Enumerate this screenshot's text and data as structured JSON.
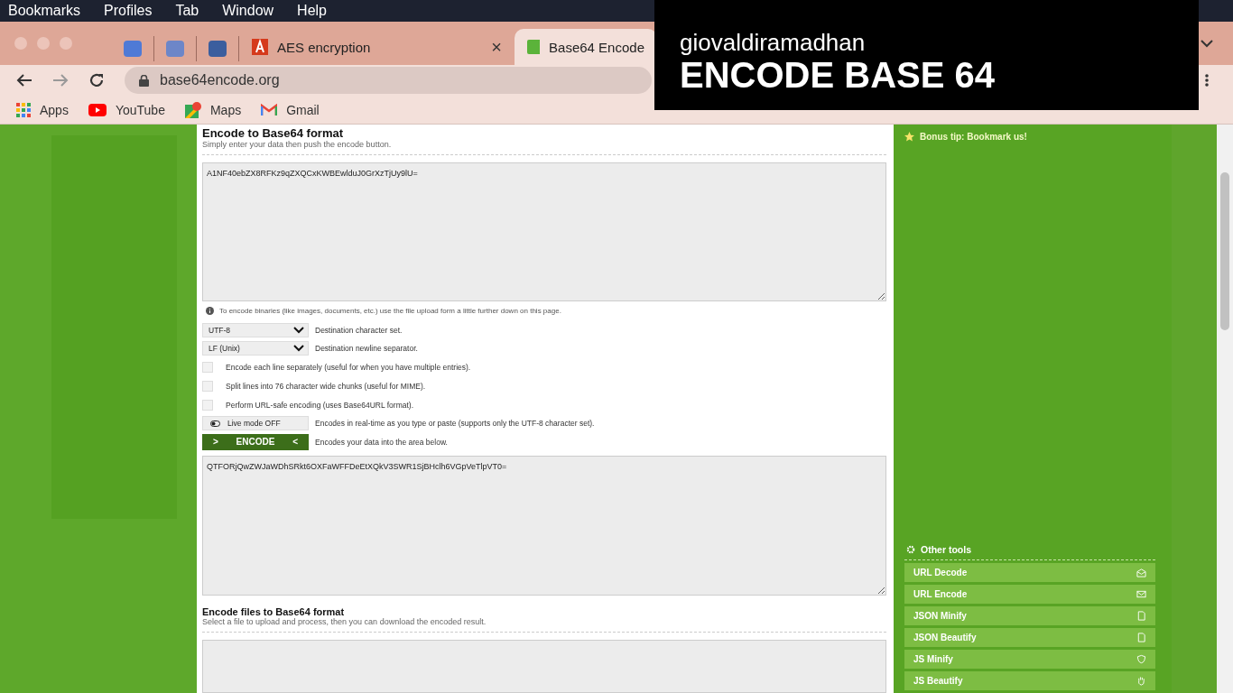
{
  "menu_bar": [
    "Bookmarks",
    "Profiles",
    "Tab",
    "Window",
    "Help"
  ],
  "tabs": [
    {
      "kind": "icon",
      "selected": false
    },
    {
      "kind": "icon",
      "selected": false
    },
    {
      "kind": "icon",
      "selected": false
    },
    {
      "kind": "page",
      "label": "AES encryption",
      "close": "×",
      "selected": false
    },
    {
      "kind": "page",
      "label": "Base64 Encode",
      "selected": true
    }
  ],
  "address": "base64encode.org",
  "bookmarks": [
    {
      "label": "Apps",
      "kind": "apps"
    },
    {
      "label": "YouTube",
      "kind": "youtube"
    },
    {
      "label": "Maps",
      "kind": "maps"
    },
    {
      "label": "Gmail",
      "kind": "gmail"
    }
  ],
  "overlay": {
    "author": "giovaldiramadhan",
    "headline": "ENCODE BASE 64"
  },
  "encode": {
    "title": "Encode to Base64 format",
    "subtitle": "Simply enter your data then push the encode button.",
    "input": "A1NF40ebZX8RFKz9qZXQCxKWBEwlduJ0GrXzTjUy9lU=",
    "info": "To encode binaries (like images, documents, etc.) use the file upload form a little further down on this page.",
    "selects": [
      {
        "value": "UTF-8",
        "label": "Destination character set."
      },
      {
        "value": "LF (Unix)",
        "label": "Destination newline separator."
      }
    ],
    "options": [
      {
        "label": "Encode each line separately (useful for when you have multiple entries).",
        "checked": false
      },
      {
        "label": "Split lines into 76 character wide chunks (useful for MIME).",
        "checked": false
      },
      {
        "label": "Perform URL-safe encoding (uses Base64URL format).",
        "checked": false
      }
    ],
    "live_mode": {
      "button": "Live mode OFF",
      "label": "Encodes in real-time as you type or paste (supports only the UTF-8 character set)."
    },
    "encode_button": {
      "button": "ENCODE",
      "left": ">",
      "right": "<",
      "label": "Encodes your data into the area below."
    },
    "output": "QTFORjQwZWJaWDhSRkt6OXFaWFFDeEtXQkV3SWR1SjBHclh6VGpVeTlpVT0="
  },
  "files": {
    "title": "Encode files to Base64 format",
    "subtitle": "Select a file to upload and process, then you can download the encoded result."
  },
  "sidebar": {
    "tip": "Bonus tip: Bookmark us!",
    "tools_title": "Other tools",
    "tools": [
      {
        "label": "URL Decode",
        "kind": "envelope-open"
      },
      {
        "label": "URL Encode",
        "kind": "envelope"
      },
      {
        "label": "JSON Minify",
        "kind": "file"
      },
      {
        "label": "JSON Beautify",
        "kind": "file"
      },
      {
        "label": "JS Minify",
        "kind": "shield"
      },
      {
        "label": "JS Beautify",
        "kind": "hand"
      }
    ]
  }
}
